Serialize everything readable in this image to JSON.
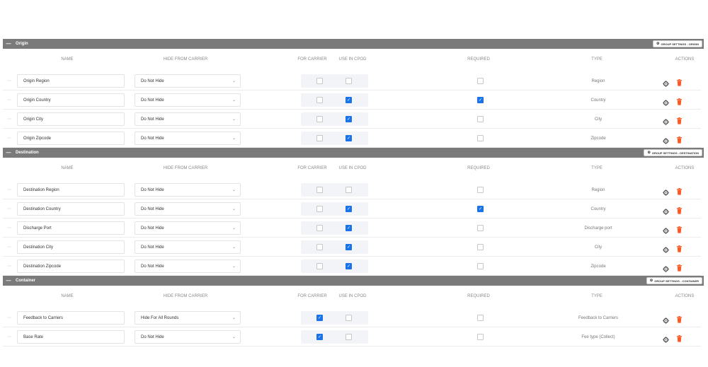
{
  "columns": {
    "name": "NAME",
    "hide_from_carrier": "HIDE FROM CARRIER",
    "for_carrier": "FOR CARRIER",
    "use_in_cpod": "USE IN CPOD",
    "required": "REQUIRED",
    "type": "TYPE",
    "actions": "ACTIONS"
  },
  "colors": {
    "header_bg": "#7a7a7a",
    "checkbox_checked": "#1a73e8",
    "trash": "#ff5722"
  },
  "groups": [
    {
      "title": "Origin",
      "settings_label": "GROUP SETTINGS - ORIGIN",
      "rows": [
        {
          "name": "Origin Region",
          "hide": "Do Not Hide",
          "for_carrier": false,
          "use_in_cpod": false,
          "required": false,
          "type": "Region"
        },
        {
          "name": "Origin Country",
          "hide": "Do Not Hide",
          "for_carrier": false,
          "use_in_cpod": true,
          "required": true,
          "type": "Country"
        },
        {
          "name": "Origin City",
          "hide": "Do Not Hide",
          "for_carrier": false,
          "use_in_cpod": true,
          "required": false,
          "type": "City"
        },
        {
          "name": "Origin Zipcode",
          "hide": "Do Not Hide",
          "for_carrier": false,
          "use_in_cpod": true,
          "required": false,
          "type": "Zipcode"
        }
      ]
    },
    {
      "title": "Destination",
      "settings_label": "GROUP SETTINGS - DESTINATION",
      "rows": [
        {
          "name": "Destination Region",
          "hide": "Do Not Hide",
          "for_carrier": false,
          "use_in_cpod": false,
          "required": false,
          "type": "Region"
        },
        {
          "name": "Destination Country",
          "hide": "Do Not Hide",
          "for_carrier": false,
          "use_in_cpod": true,
          "required": true,
          "type": "Country"
        },
        {
          "name": "Discharge Port",
          "hide": "Do Not Hide",
          "for_carrier": false,
          "use_in_cpod": true,
          "required": false,
          "type": "Discharge port"
        },
        {
          "name": "Destination City",
          "hide": "Do Not Hide",
          "for_carrier": false,
          "use_in_cpod": true,
          "required": false,
          "type": "City"
        },
        {
          "name": "Destination Zipcode",
          "hide": "Do Not Hide",
          "for_carrier": false,
          "use_in_cpod": true,
          "required": false,
          "type": "Zipcode"
        }
      ]
    },
    {
      "title": "Container",
      "settings_label": "GROUP SETTINGS - CONTAINER",
      "rows": [
        {
          "name": "Feedback to Carriers",
          "hide": "Hide For All Rounds",
          "for_carrier": true,
          "use_in_cpod": false,
          "required": false,
          "type": "Feedback to Carriers"
        },
        {
          "name": "Base Rate",
          "hide": "Do Not Hide",
          "for_carrier": true,
          "use_in_cpod": false,
          "required": false,
          "type": "Fee type (Collect)"
        }
      ]
    }
  ]
}
